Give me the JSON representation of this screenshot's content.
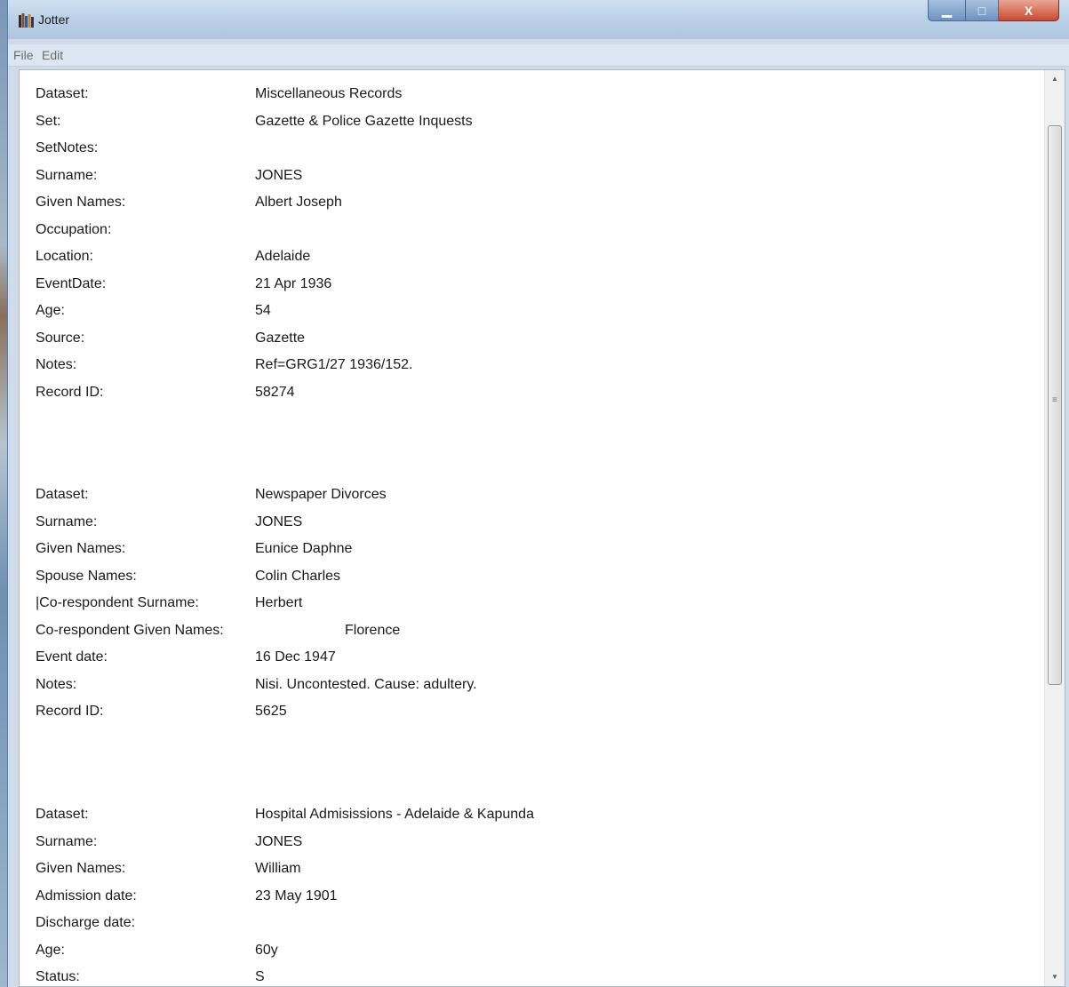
{
  "window": {
    "title": "Jotter",
    "minimize_label": "▁",
    "maximize_label": "□",
    "close_label": "X"
  },
  "menu": [
    "File",
    "Edit"
  ],
  "records": [
    {
      "rows": [
        {
          "label": "Dataset:",
          "value": "Miscellaneous Records"
        },
        {
          "label": "Set:",
          "value": "Gazette & Police Gazette Inquests"
        },
        {
          "label": "SetNotes:",
          "value": ""
        },
        {
          "label": "Surname:",
          "value": "JONES"
        },
        {
          "label": "Given Names:",
          "value": "Albert Joseph"
        },
        {
          "label": "Occupation:",
          "value": ""
        },
        {
          "label": "Location:",
          "value": "Adelaide"
        },
        {
          "label": "EventDate:",
          "value": "21 Apr 1936"
        },
        {
          "label": "Age:",
          "value": "54"
        },
        {
          "label": "Source:",
          "value": "Gazette"
        },
        {
          "label": "Notes:",
          "value": "Ref=GRG1/27 1936/152."
        },
        {
          "label": "Record ID:",
          "value": "58274"
        }
      ]
    },
    {
      "rows": [
        {
          "label": "Dataset:",
          "value": "Newspaper Divorces"
        },
        {
          "label": "Surname:",
          "value": "JONES"
        },
        {
          "label": "Given Names:",
          "value": "Eunice Daphne"
        },
        {
          "label": "Spouse Names:",
          "value": "Colin Charles"
        },
        {
          "label": "|Co-respondent Surname:",
          "value": "Herbert"
        },
        {
          "label": "Co-respondent Given Names:",
          "value": "Florence"
        },
        {
          "label": "Event date:",
          "value": "16 Dec 1947"
        },
        {
          "label": "Notes:",
          "value": "Nisi. Uncontested. Cause: adultery."
        },
        {
          "label": "Record ID:",
          "value": "5625"
        }
      ]
    },
    {
      "rows": [
        {
          "label": "Dataset:",
          "value": "Hospital Admisissions - Adelaide & Kapunda"
        },
        {
          "label": "Surname:",
          "value": "JONES"
        },
        {
          "label": "Given Names:",
          "value": "William"
        },
        {
          "label": "Admission date:",
          "value": "23 May 1901"
        },
        {
          "label": "Discharge date:",
          "value": ""
        },
        {
          "label": "Age:",
          "value": "60y"
        },
        {
          "label": "Status:",
          "value": "S"
        }
      ]
    }
  ],
  "scrollbar": {
    "up": "▲",
    "down": "▼",
    "grip": "≡"
  }
}
